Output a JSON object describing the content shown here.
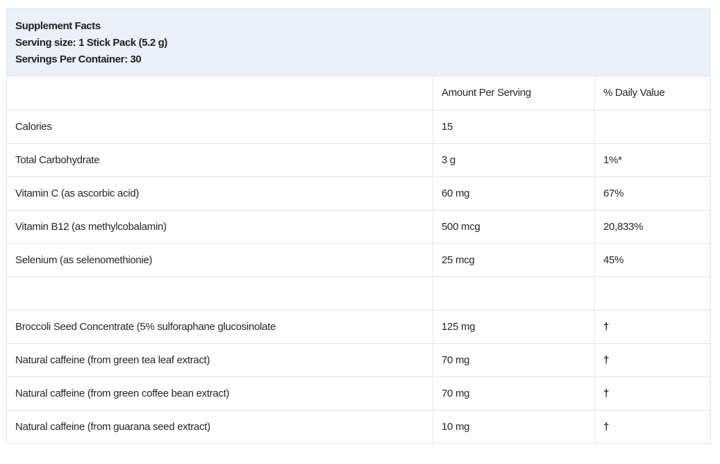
{
  "header": {
    "title": "Supplement Facts",
    "serving_size": "Serving size: 1 Stick Pack (5.2 g)",
    "servings_per_container": "Servings Per Container: 30"
  },
  "columns": {
    "nutrient": "",
    "amount": "Amount Per Serving",
    "daily_value": "% Daily Value"
  },
  "rows": [
    {
      "nutrient": "Calories",
      "amount": "15",
      "daily_value": ""
    },
    {
      "nutrient": "Total Carbohydrate",
      "amount": "3 g",
      "daily_value": "1%*"
    },
    {
      "nutrient": "Vitamin C (as ascorbic acid)",
      "amount": "60 mg",
      "daily_value": "67%"
    },
    {
      "nutrient": "Vitamin B12 (as methylcobalamin)",
      "amount": "500 mcg",
      "daily_value": "20,833%"
    },
    {
      "nutrient": "Selenium (as selenomethionie)",
      "amount": "25 mcg",
      "daily_value": "45%"
    },
    {
      "nutrient": "",
      "amount": "",
      "daily_value": ""
    },
    {
      "nutrient": "Broccoli Seed Concentrate (5% sulforaphane glucosinolate",
      "amount": "125 mg",
      "daily_value": "†"
    },
    {
      "nutrient": "Natural caffeine (from green tea leaf extract)",
      "amount": "70 mg",
      "daily_value": "†"
    },
    {
      "nutrient": "Natural caffeine (from green coffee bean extract)",
      "amount": "70 mg",
      "daily_value": "†"
    },
    {
      "nutrient": "Natural caffeine (from guarana seed extract)",
      "amount": "10 mg",
      "daily_value": "†"
    }
  ]
}
